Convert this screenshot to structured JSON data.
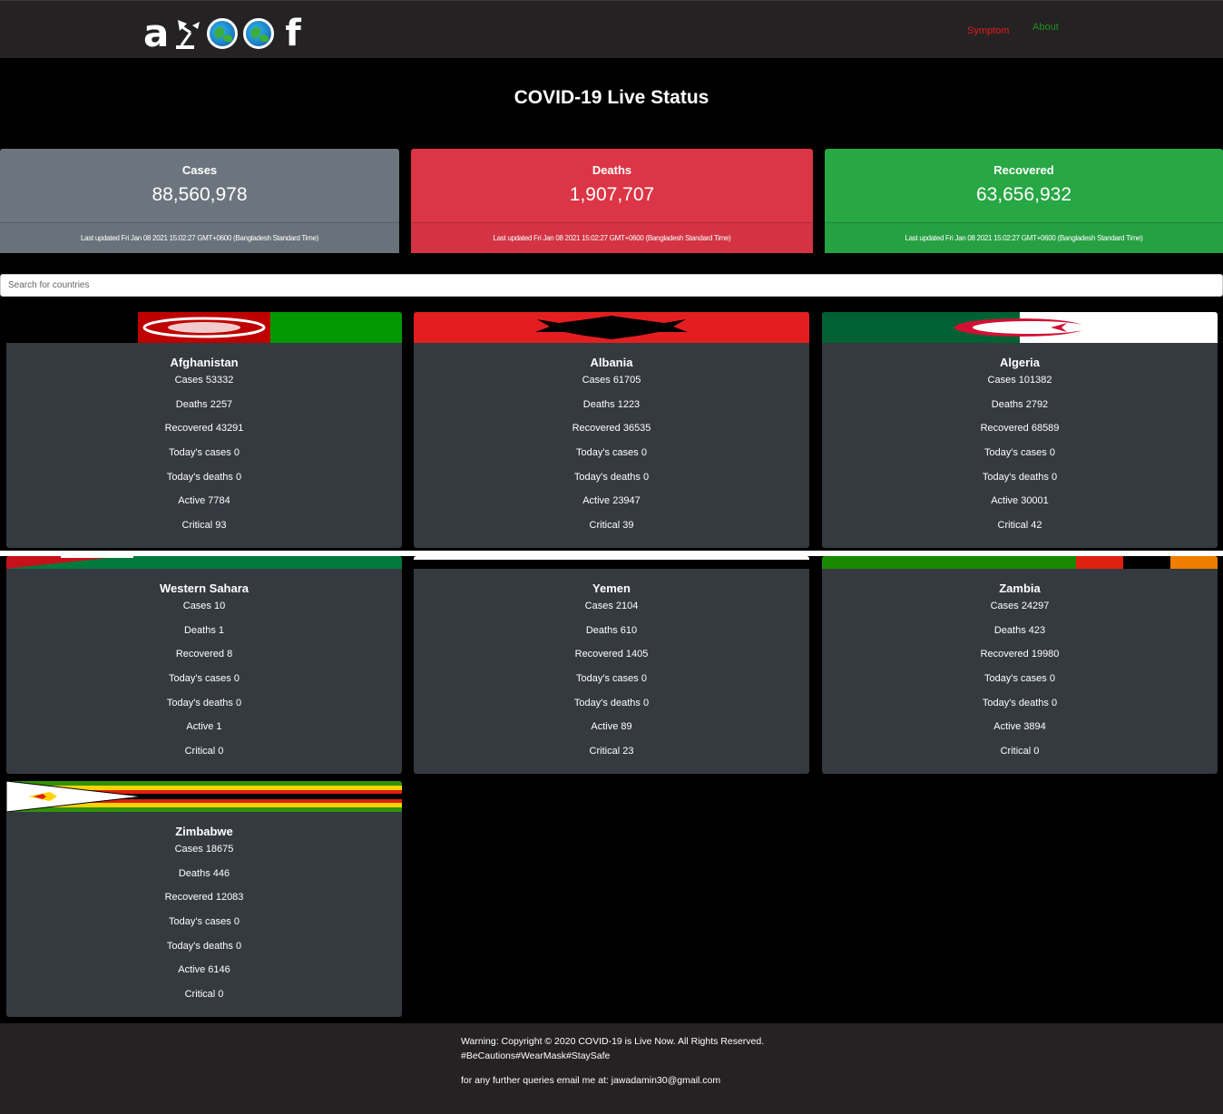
{
  "nav": {
    "brand_letter": "a",
    "brand_fb": "f",
    "symptom_label": "Symptom",
    "about_label": "About"
  },
  "page": {
    "title": "COVID-19 Live Status"
  },
  "summary": {
    "cases": {
      "title": "Cases",
      "value": "88,560,978",
      "updated": "Last updated Fri Jan 08 2021 15:02:27 GMT+0600 (Bangladesh Standard Time)"
    },
    "deaths": {
      "title": "Deaths",
      "value": "1,907,707",
      "updated": "Last updated Fri Jan 08 2021 15:02:27 GMT+0600 (Bangladesh Standard Time)"
    },
    "recovered": {
      "title": "Recovered",
      "value": "63,656,932",
      "updated": "Last updated Fri Jan 08 2021 15:02:27 GMT+0600 (Bangladesh Standard Time)"
    }
  },
  "search": {
    "placeholder": "Search for countries"
  },
  "countries": [
    {
      "name": "Afghanistan",
      "cases": "Cases 53332",
      "deaths": "Deaths 2257",
      "recovered": "Recovered 43291",
      "today_cases": "Today's cases 0",
      "today_deaths": "Today's deaths 0",
      "active": "Active 7784",
      "critical": "Critical 93"
    },
    {
      "name": "Albania",
      "cases": "Cases 61705",
      "deaths": "Deaths 1223",
      "recovered": "Recovered 36535",
      "today_cases": "Today's cases 0",
      "today_deaths": "Today's deaths 0",
      "active": "Active 23947",
      "critical": "Critical 39"
    },
    {
      "name": "Algeria",
      "cases": "Cases 101382",
      "deaths": "Deaths 2792",
      "recovered": "Recovered 68589",
      "today_cases": "Today's cases 0",
      "today_deaths": "Today's deaths 0",
      "active": "Active 30001",
      "critical": "Critical 42"
    },
    {
      "name": "Western Sahara",
      "cases": "Cases 10",
      "deaths": "Deaths 1",
      "recovered": "Recovered 8",
      "today_cases": "Today's cases 0",
      "today_deaths": "Today's deaths 0",
      "active": "Active 1",
      "critical": "Critical 0"
    },
    {
      "name": "Yemen",
      "cases": "Cases 2104",
      "deaths": "Deaths 610",
      "recovered": "Recovered 1405",
      "today_cases": "Today's cases 0",
      "today_deaths": "Today's deaths 0",
      "active": "Active 89",
      "critical": "Critical 23"
    },
    {
      "name": "Zambia",
      "cases": "Cases 24297",
      "deaths": "Deaths 423",
      "recovered": "Recovered 19980",
      "today_cases": "Today's cases 0",
      "today_deaths": "Today's deaths 0",
      "active": "Active 3894",
      "critical": "Critical 0"
    },
    {
      "name": "Zimbabwe",
      "cases": "Cases 18675",
      "deaths": "Deaths 446",
      "recovered": "Recovered 12083",
      "today_cases": "Today's cases 0",
      "today_deaths": "Today's deaths 0",
      "active": "Active 6146",
      "critical": "Critical 0"
    }
  ],
  "footer": {
    "copyright": "Warning: Copyright © 2020 COVID-19 is Live Now. All Rights Reserved.",
    "tags": "#BeCautions#WearMask#StaySafe",
    "contact": "for any further queries email me at: jawadamin30@gmail.com"
  },
  "colors": {
    "navbar_bg": "#252223",
    "cases_card": "#6c757d",
    "deaths_card": "#dc3545",
    "recovered_card": "#28a745",
    "country_card": "#343a40",
    "symptom_link": "#e31b1b",
    "about_link": "#1f8f1f"
  },
  "icons": [
    "brand-logo-icon",
    "desk-lamp-icon",
    "globe-icon",
    "globe-icon",
    "facebook-icon"
  ]
}
